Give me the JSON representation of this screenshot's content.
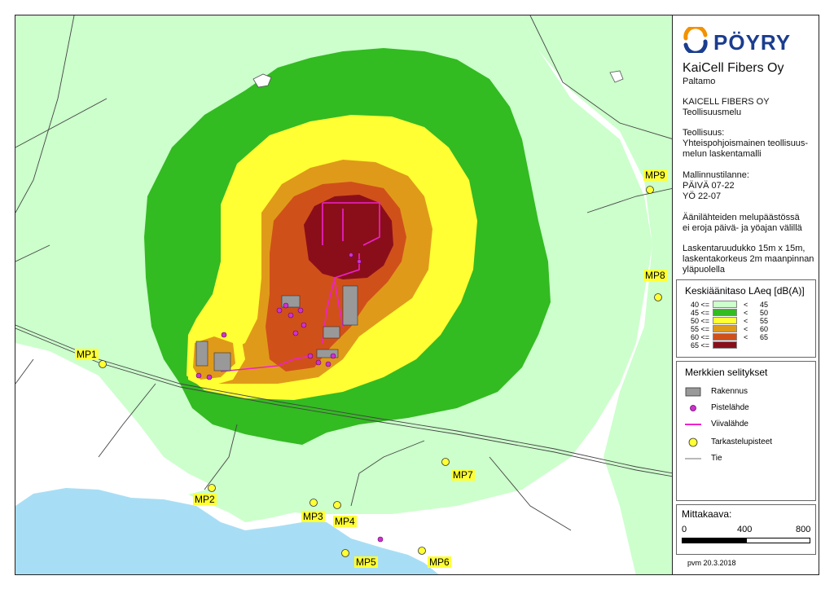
{
  "colors": {
    "band_40_45": "#ccffcc",
    "band_45_50": "#33bb22",
    "band_50_55": "#ffff33",
    "band_55_60": "#e09a1a",
    "band_60_65": "#d0501a",
    "band_65_plus": "#8a0e1a",
    "water": "#a8def5",
    "measure_point": "#ffff33",
    "logo_blue": "#1b3d8f"
  },
  "logo": {
    "text": "PÖYRY"
  },
  "header": {
    "company": "KaiCell Fibers Oy",
    "place": "Paltamo",
    "project_line1": "KAICELL FIBERS OY",
    "project_line2": "Teollisuusmelu",
    "model_line1": "Teollisuus:",
    "model_line2": "Yhteispohjoismainen teollisuus-",
    "model_line3": "melun laskentamalli",
    "scenario_line1": "Mallinnustilanne:",
    "scenario_line2": "PÄIVÄ 07-22",
    "scenario_line3": "YÖ 22-07",
    "note1_line1": "Äänilähteiden melupäästössä",
    "note1_line2": "ei eroja päivä- ja yöajan välillä",
    "note2_line1": "Laskentaruudukko 15m x 15m,",
    "note2_line2": "laskentakorkeus 2m maanpinnan",
    "note2_line3": "yläpuolella"
  },
  "noise_legend": {
    "title": "Keskiäänitaso LAeq [dB(A)]",
    "rows": [
      {
        "low": "40 <=",
        "lt": "<",
        "high": "45"
      },
      {
        "low": "45 <=",
        "lt": "<",
        "high": "50"
      },
      {
        "low": "50 <=",
        "lt": "<",
        "high": "55"
      },
      {
        "low": "55 <=",
        "lt": "<",
        "high": "60"
      },
      {
        "low": "60 <=",
        "lt": "<",
        "high": "65"
      },
      {
        "low": "65 <=",
        "lt": "",
        "high": ""
      }
    ]
  },
  "symbols": {
    "title": "Merkkien selitykset",
    "items": [
      {
        "label": "Rakennus",
        "icon": "building-icon"
      },
      {
        "label": "Pistelähde",
        "icon": "point-source-icon"
      },
      {
        "label": "Viivalähde",
        "icon": "line-source-icon"
      },
      {
        "label": "Tarkastelupisteet",
        "icon": "receiver-point-icon"
      },
      {
        "label": "Tie",
        "icon": "road-icon"
      }
    ]
  },
  "scale": {
    "title": "Mittakaava:",
    "labels": [
      "0",
      "400",
      "800"
    ]
  },
  "date": "pvm 20.3.2018",
  "measure_points": [
    {
      "id": "mp1",
      "label": "MP1"
    },
    {
      "id": "mp2",
      "label": "MP2"
    },
    {
      "id": "mp3",
      "label": "MP3"
    },
    {
      "id": "mp4",
      "label": "MP4"
    },
    {
      "id": "mp5",
      "label": "MP5"
    },
    {
      "id": "mp6",
      "label": "MP6"
    },
    {
      "id": "mp7",
      "label": "MP7"
    },
    {
      "id": "mp8",
      "label": "MP8"
    },
    {
      "id": "mp9",
      "label": "MP9"
    }
  ]
}
